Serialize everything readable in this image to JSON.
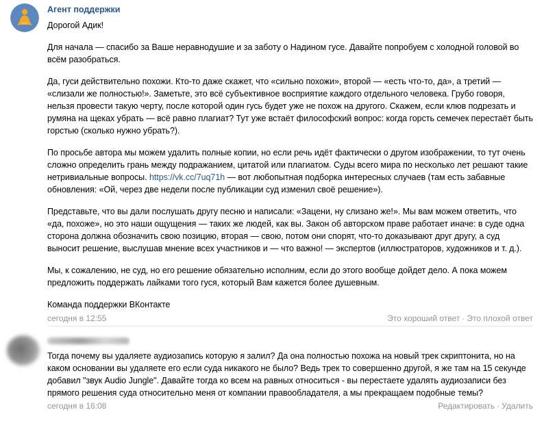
{
  "message1": {
    "author": "Агент поддержки",
    "greeting": "Дорогой Адик!",
    "paragraphs": [
      "Для начала — спасибо за Ваше неравнодушие и за заботу о Надином гусе. Давайте попробуем с холодной головой во всём разобраться.",
      "Да, гуси действительно похожи. Кто-то даже скажет, что «сильно похожи», второй — «есть что-то, да», а третий — «слизали же полностью!». Заметьте, это всё субъективное восприятие каждого отдельного человека. Грубо говоря, нельзя провести такую черту, после которой один гусь будет уже не похож на другого. Скажем, если клюв подрезать и румяна на щеках убрать — всё равно плагиат? Тут уже встаёт философский вопрос: когда горсть семечек перестаёт быть горстью (сколько нужно убрать?).",
      "Представьте, что вы дали послушать другу песню и написали: «Зацени, ну слизано же!». Мы вам можем ответить, что «да, похоже», но это наши ощущения — таких же людей, как вы. Закон об авторском праве работает иначе: в суде одна сторона должна обозначить свою позицию, вторая — свою, потом они спорят, что-то доказывают друг другу, а суд выносит решение, выслушав мнение всех участников и — что важно! — экспертов (иллюстраторов, художников и т. д.).",
      "Мы, к сожалению, не суд, но его решение обязательно исполним, если до этого вообще дойдет дело. А пока можем предложить поддержать лайками того гуся, который Вам кажется более душевным."
    ],
    "paragraph3_before": "По просьбе автора мы можем удалить полные копии, но если речь идёт фактически о другом изображении, то тут очень сложно определить грань между подражанием, цитатой или плагиатом. Суды всего мира по несколько лет решают такие нетривиальные вопросы. ",
    "paragraph3_link": "https://vk.cc/7uq71h",
    "paragraph3_after": " — вот любопытная подборка интересных случаев (там есть забавные обновления: «Ой, через две недели после публикации суд изменил своё решение»).",
    "signature": "Команда поддержки ВКонтакте",
    "time": "сегодня в 12:55",
    "good_answer": "Это хороший ответ",
    "separator": "·",
    "bad_answer": "Это плохой ответ"
  },
  "message2": {
    "text": "Тогда почему вы удаляете аудиозапись которую я залил? Да она полностью похожа на новый трек скриптонита, но на каком основании вы удаляете его если суда никакого не было? Ведь трек то совершенно другой, я же там на 15 секунде добавил \"звук Audio Jungle\". Давайте тогда ко всем на равных относиться - вы перестаете удалять аудиозаписи без прямого решения суда относительно меня от компании правообладателя, а мы прекращаем подобные темы?",
    "time": "сегодня в 16:08",
    "edit": "Редактировать",
    "separator": "·",
    "delete": "Удалить"
  },
  "colors": {
    "author_link": "#2a5885",
    "meta_gray": "#939393",
    "divider": "#e7e8ec",
    "support_avatar_bg": "#5b88bd",
    "support_avatar_figure": "#f5a623"
  }
}
